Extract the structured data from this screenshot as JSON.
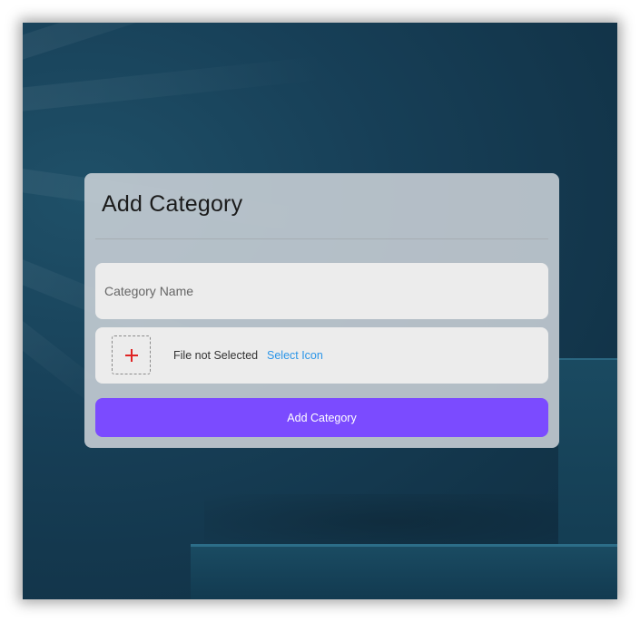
{
  "dialog": {
    "title": "Add Category",
    "name_field": {
      "placeholder": "Category Name",
      "value": ""
    },
    "file_picker": {
      "icon": "plus-icon",
      "status_text": "File not Selected",
      "select_label": "Select Icon"
    },
    "submit_label": "Add Category"
  },
  "colors": {
    "accent": "#7b4bff",
    "link": "#2b95e8",
    "plus": "#e02424",
    "background": "#173f57"
  }
}
